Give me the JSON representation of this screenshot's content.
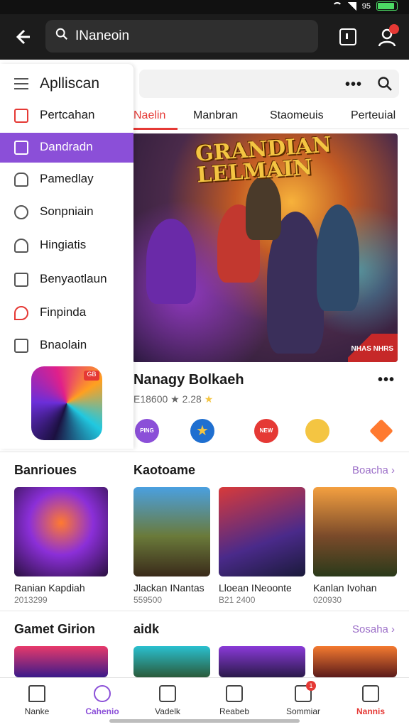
{
  "status": {
    "time": "",
    "battery_text": "95"
  },
  "topbar": {
    "search_value": "INaneoin"
  },
  "tabs": [
    {
      "label": "Naelin",
      "active": true
    },
    {
      "label": "Manbran",
      "active": false
    },
    {
      "label": "Staomeuis",
      "active": false
    },
    {
      "label": "Perteuial",
      "active": false
    }
  ],
  "hero": {
    "logo_line1": "GRANDIAN",
    "logo_line2": "LELMAIN",
    "badge": "NHAS NHRS"
  },
  "featured": {
    "title": "Nanagy Bolkaeh",
    "meta": "E18600 ★ 2.28",
    "chips": [
      "PING",
      "",
      "NEW",
      "",
      ""
    ]
  },
  "drawer": {
    "header": "Aplliscan",
    "items": [
      {
        "label": "Pertcahan",
        "icon": "card-icon",
        "active": false
      },
      {
        "label": "Dandradn",
        "icon": "chat-icon",
        "active": true
      },
      {
        "label": "Pamedlay",
        "icon": "lock-icon",
        "active": false
      },
      {
        "label": "Sonpniain",
        "icon": "search-person-icon",
        "active": false
      },
      {
        "label": "Hingiatis",
        "icon": "person-icon",
        "active": false
      },
      {
        "label": "Benyaotlaun",
        "icon": "info-icon",
        "active": false
      },
      {
        "label": "Finpinda",
        "icon": "location-icon",
        "active": false
      },
      {
        "label": "Bnaolain",
        "icon": "edit-icon",
        "active": false
      }
    ],
    "app_tag": "GB"
  },
  "section1": {
    "left_title": "Banrioues",
    "right_title": "Kaotoame",
    "link": "Boacha",
    "cards": [
      {
        "name": "Ranian Kapdiah",
        "num": "2013299"
      },
      {
        "name": "Jlackan INantas",
        "num": "559500"
      },
      {
        "name": "Lloean INeoonte",
        "num": "B21 2400"
      },
      {
        "name": "Kanlan Ivohan",
        "num": "020930"
      }
    ]
  },
  "section2": {
    "left_title": "Gamet Girion",
    "right_title": "aidk",
    "link": "Sosaha"
  },
  "bottomnav": [
    {
      "label": "Nanke",
      "state": ""
    },
    {
      "label": "Cahenio",
      "state": "active"
    },
    {
      "label": "Vadelk",
      "state": ""
    },
    {
      "label": "Reabeb",
      "state": ""
    },
    {
      "label": "Sommiar",
      "state": "badge",
      "badge": "1"
    },
    {
      "label": "Nannis",
      "state": "red"
    }
  ],
  "colors": {
    "accent": "#8b4fd8",
    "brand_red": "#e53935",
    "topbar": "#1c1c1c"
  }
}
